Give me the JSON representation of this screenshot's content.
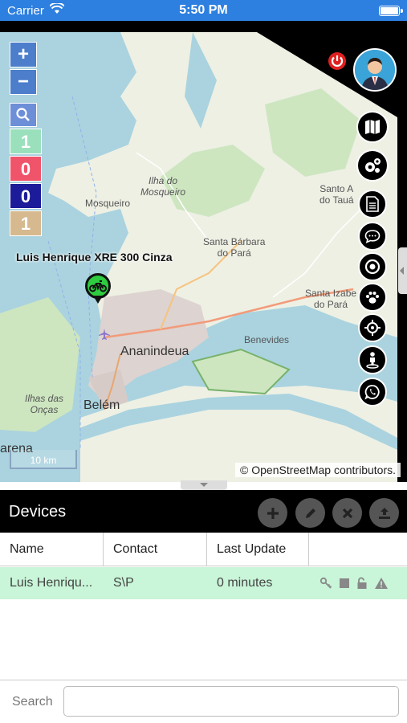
{
  "status_bar": {
    "carrier": "Carrier",
    "time": "5:50 PM"
  },
  "map": {
    "zoom_in": "+",
    "zoom_out": "−",
    "counters": [
      {
        "value": "1",
        "color": "#9be0bd"
      },
      {
        "value": "0",
        "color": "#f0546a"
      },
      {
        "value": "0",
        "color": "#1c1c9a"
      },
      {
        "value": "1",
        "color": "#d7b98f"
      }
    ],
    "labels": {
      "ilha_do_mosqueiro": "Ilha do\nMosqueiro",
      "mosqueiro": "Mosqueiro",
      "santa_barbara": "Santa Bárbara\ndo Pará",
      "santo_antonio": "Santo A\ndo Tauá",
      "santa_izabel": "Santa Izabe\ndo Pará",
      "ananindeua": "Ananindeua",
      "benevides": "Benevides",
      "ilhas_das_oncas": "Ilhas das\nOnças",
      "belem": "Belém",
      "marituba": "arena"
    },
    "device_label": "Luis Henrique XRE 300 Cinza",
    "scale": "10 km",
    "attribution": "© OpenStreetMap contributors."
  },
  "side_buttons": [
    "map-icon",
    "settings-icon",
    "document-icon",
    "chat-icon",
    "target-icon",
    "paw-icon",
    "crosshair-icon",
    "person-pin-icon",
    "whatsapp-icon"
  ],
  "devices": {
    "title": "Devices",
    "columns": [
      "Name",
      "Contact",
      "Last Update"
    ],
    "rows": [
      {
        "name": "Luis Henriqu...",
        "contact": "S\\P",
        "last_update": "0 minutes"
      }
    ]
  },
  "search": {
    "label": "Search",
    "value": "",
    "placeholder": ""
  }
}
